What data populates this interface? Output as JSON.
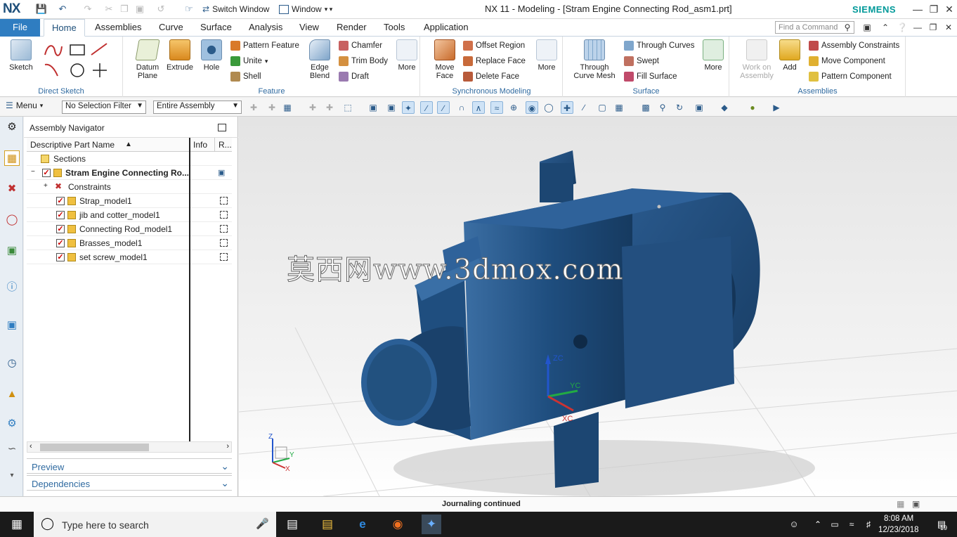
{
  "titlebar": {
    "logo": "NX",
    "switch_window": "Switch Window",
    "window_menu": "Window",
    "title": "NX 11 - Modeling - [Stram Engine Connecting Rod_asm1.prt]",
    "brand": "SIEMENS"
  },
  "tabs": {
    "file": "File",
    "items": [
      "Home",
      "Assemblies",
      "Curve",
      "Surface",
      "Analysis",
      "View",
      "Render",
      "Tools",
      "Application"
    ],
    "find_placeholder": "Find a Command"
  },
  "ribbon": {
    "direct_sketch": {
      "sketch": "Sketch",
      "label": "Direct Sketch"
    },
    "feature": {
      "datum_plane": "Datum Plane",
      "extrude": "Extrude",
      "hole": "Hole",
      "pattern_feature": "Pattern Feature",
      "unite": "Unite",
      "shell": "Shell",
      "edge_blend": "Edge Blend",
      "chamfer": "Chamfer",
      "trim_body": "Trim Body",
      "draft": "Draft",
      "more": "More",
      "label": "Feature"
    },
    "synchronous": {
      "move_face": "Move Face",
      "offset_region": "Offset Region",
      "replace_face": "Replace Face",
      "delete_face": "Delete Face",
      "more": "More",
      "label": "Synchronous Modeling"
    },
    "surface": {
      "through_curve_mesh": "Through Curve Mesh",
      "through_curves": "Through Curves",
      "swept": "Swept",
      "fill_surface": "Fill Surface",
      "more": "More",
      "label": "Surface"
    },
    "assemblies": {
      "work_on_assembly": "Work on Assembly",
      "add": "Add",
      "assembly_constraints": "Assembly Constraints",
      "move_component": "Move Component",
      "pattern_component": "Pattern Component",
      "label": "Assemblies"
    }
  },
  "cmdbar": {
    "menu": "Menu",
    "selection_filter": "No Selection Filter",
    "scope": "Entire Assembly"
  },
  "navigator": {
    "title": "Assembly Navigator",
    "columns": {
      "name": "Descriptive Part Name",
      "info": "Info",
      "r": "R..."
    },
    "sections": "Sections",
    "root": "Stram Engine Connecting Ro...",
    "constraints": "Constraints",
    "parts": [
      "Strap_model1",
      "jib and cotter_model1",
      "Connecting Rod_model1",
      "Brasses_model1",
      "set screw_model1"
    ],
    "preview": "Preview",
    "dependencies": "Dependencies"
  },
  "viewport": {
    "watermark": "莫西网www.3dmox.com",
    "axes": {
      "z": "ZC",
      "y": "YC",
      "x": "XC"
    },
    "triad": {
      "z": "Z",
      "y": "Y",
      "x": "X"
    }
  },
  "status": "Journaling continued",
  "taskbar": {
    "search": "Type here to search",
    "time": "8:08 AM",
    "date": "12/23/2018",
    "notifications": "19"
  },
  "colors": {
    "accent": "#2f7dc1",
    "model": "#1f4e7f",
    "brand": "#009999"
  }
}
